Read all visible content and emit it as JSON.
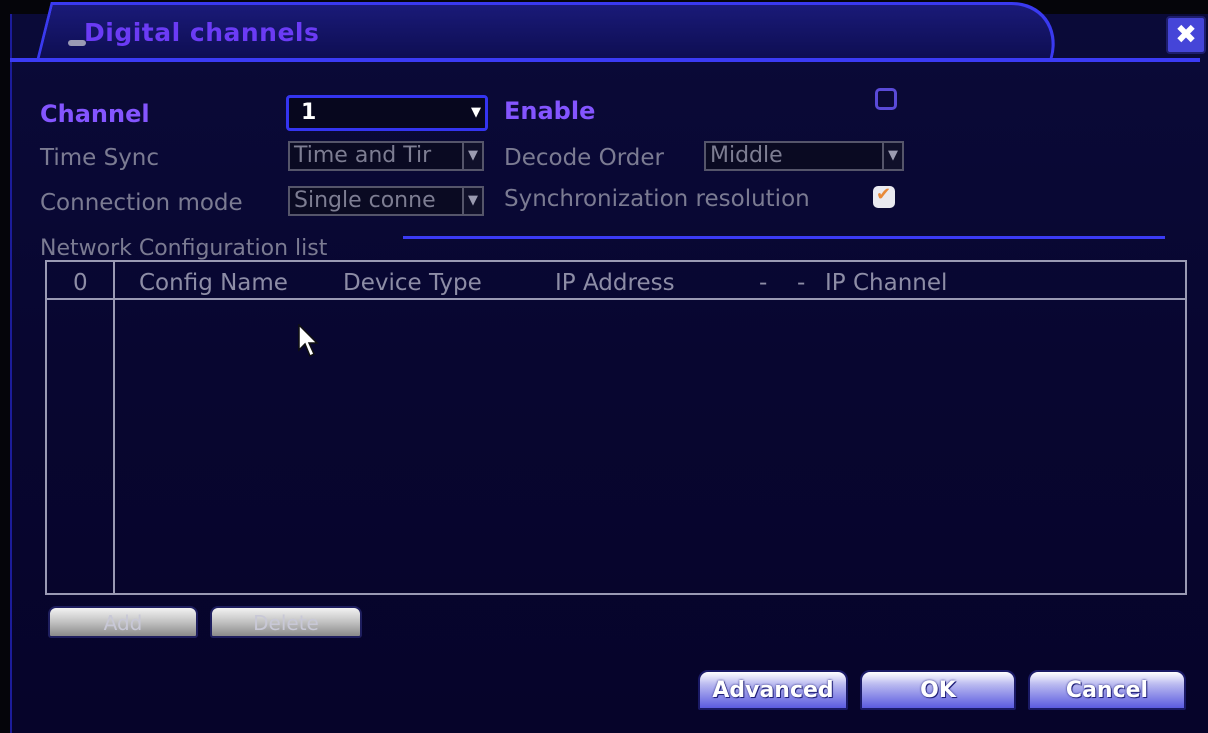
{
  "window": {
    "title": "Digital channels",
    "close_label": "✖"
  },
  "form": {
    "channel": {
      "label": "Channel",
      "value": "1"
    },
    "enable": {
      "label": "Enable",
      "checked": false
    },
    "time_sync": {
      "label": "Time Sync",
      "value": "Time and Tir"
    },
    "decode_order": {
      "label": "Decode Order",
      "value": "Middle"
    },
    "connection_mode": {
      "label": "Connection mode",
      "value": "Single conne"
    },
    "sync_resolution": {
      "label": "Synchronization resolution",
      "checked": true
    }
  },
  "network_list": {
    "section_label": "Network Configuration list",
    "columns": [
      "0",
      "Config Name",
      "Device Type",
      "IP Address",
      "-",
      "-",
      "IP Channel"
    ],
    "rows": []
  },
  "buttons": {
    "add": "Add",
    "delete": "Delete",
    "advanced": "Advanced",
    "ok": "OK",
    "cancel": "Cancel"
  },
  "colors": {
    "background": "#08063a",
    "accent_border": "#3b3bf5",
    "active_label": "#8455ff",
    "dim_label": "#7b7b92",
    "checkmark": "#e88a3a"
  }
}
